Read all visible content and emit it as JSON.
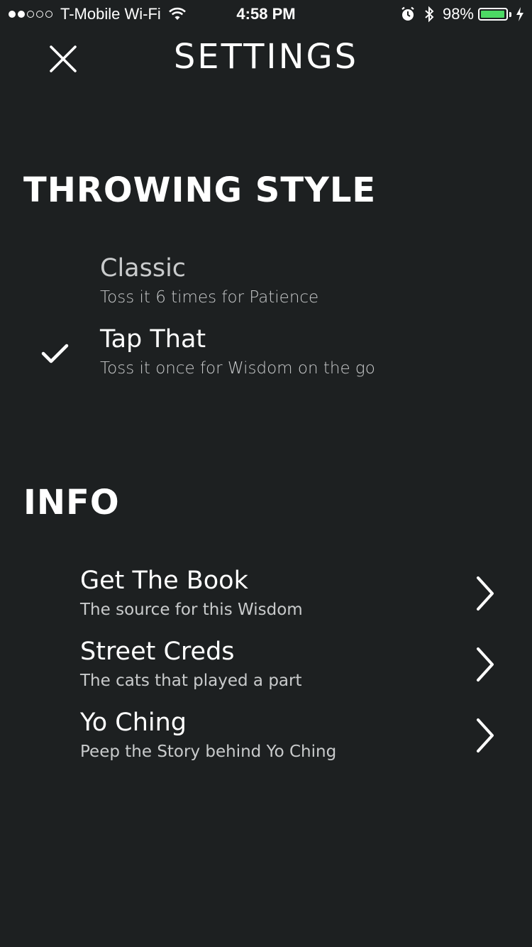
{
  "status_bar": {
    "signal_filled": 2,
    "signal_total": 5,
    "carrier": "T-Mobile Wi-Fi",
    "time": "4:58 PM",
    "battery_percent": "98%",
    "battery_level": 0.98,
    "battery_color": "#4cd964"
  },
  "nav": {
    "title": "SETTINGS",
    "close_icon": "close-icon"
  },
  "throwing_style": {
    "heading": "THROWING STYLE",
    "options": [
      {
        "title": "Classic",
        "subtitle": "Toss it 6 times for Patience",
        "selected": false
      },
      {
        "title": "Tap That",
        "subtitle": "Toss it once for Wisdom on the go",
        "selected": true
      }
    ]
  },
  "info": {
    "heading": "INFO",
    "items": [
      {
        "title": "Get The Book",
        "subtitle": "The source for this Wisdom"
      },
      {
        "title": "Street Creds",
        "subtitle": "The cats that played a part"
      },
      {
        "title": "Yo Ching",
        "subtitle": "Peep the Story behind Yo Ching"
      }
    ]
  },
  "colors": {
    "background": "#1d2021",
    "text": "#ffffff",
    "subtext": "#c9cbcc"
  }
}
